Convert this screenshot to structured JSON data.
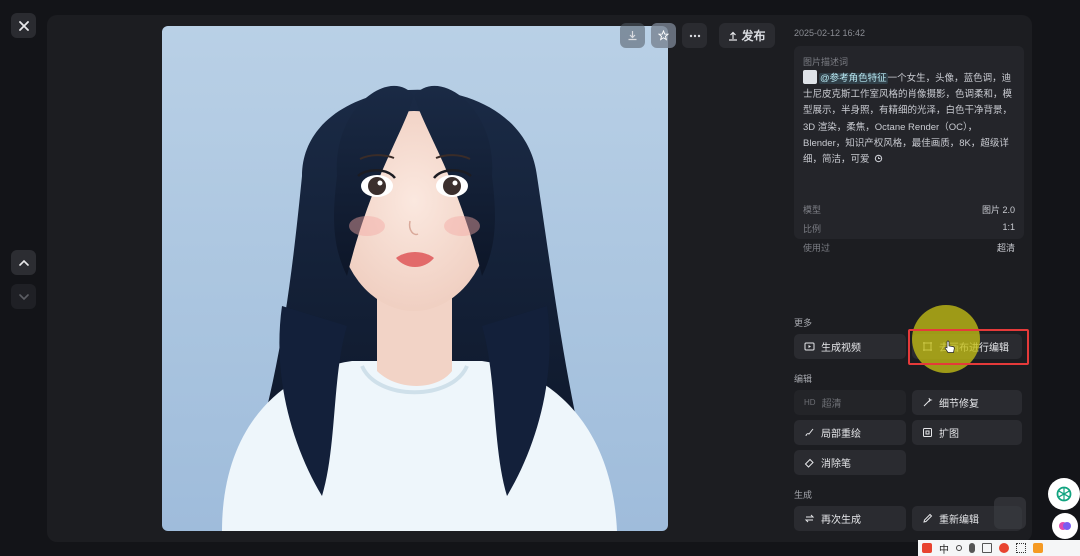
{
  "nav": {
    "close_icon": "close-icon",
    "up_icon": "chevron-up-icon",
    "down_icon": "chevron-down-icon"
  },
  "toolbar": {
    "publish_label": "发布"
  },
  "panel": {
    "timestamp": "2025-02-12 16:42",
    "desc_title": "图片描述词",
    "ref_tag": "@参考角色特征",
    "description": "一个女生，头像，蓝色调，迪士尼皮克斯工作室风格的肖像摄影，色调柔和，模型展示，半身照，有精细的光泽，白色干净背景，3D 渲染，柔焦，Octane Render（OC），Blender，知识产权风格，最佳画质，8K，超级详细，简洁，可爱",
    "meta": [
      {
        "key": "模型",
        "value": "图片 2.0"
      },
      {
        "key": "比例",
        "value": "1:1"
      },
      {
        "key": "使用过",
        "value": "超清"
      }
    ]
  },
  "sections": {
    "more": "更多",
    "edit": "编辑",
    "generate": "生成"
  },
  "buttons": {
    "gen_video": "生成视频",
    "canvas_edit": "去画布进行编辑",
    "hd_prefix": "HD",
    "hd": "超清",
    "detail_fix": "细节修复",
    "local_repaint": "局部重绘",
    "expand": "扩图",
    "eraser": "消除笔",
    "regenerate": "再次生成",
    "re_edit": "重新编辑"
  },
  "taskbar": {
    "ime": "中"
  },
  "colors": {
    "accent_highlight": "#e53a3a",
    "cursor": "#c3be14",
    "panel_bg": "#1c1d21"
  }
}
